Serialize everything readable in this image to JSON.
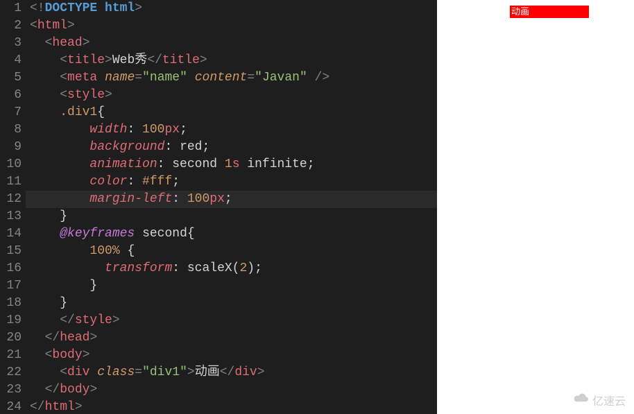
{
  "editor": {
    "line_count": 24,
    "highlighted_line": 12,
    "lines": [
      {
        "n": 1,
        "t": [
          [
            "brkt",
            "<!"
          ],
          [
            "doctype",
            "DOCTYPE html"
          ],
          [
            "brkt",
            ">"
          ]
        ]
      },
      {
        "n": 2,
        "t": [
          [
            "brkt",
            "<"
          ],
          [
            "tag",
            "html"
          ],
          [
            "brkt",
            ">"
          ]
        ]
      },
      {
        "n": 3,
        "t": [
          [
            "txt",
            "  "
          ],
          [
            "brkt",
            "<"
          ],
          [
            "tag",
            "head"
          ],
          [
            "brkt",
            ">"
          ]
        ]
      },
      {
        "n": 4,
        "t": [
          [
            "txt",
            "    "
          ],
          [
            "brkt",
            "<"
          ],
          [
            "tag",
            "title"
          ],
          [
            "brkt",
            ">"
          ],
          [
            "txt",
            "Web秀"
          ],
          [
            "brkt",
            "</"
          ],
          [
            "tag",
            "title"
          ],
          [
            "brkt",
            ">"
          ]
        ]
      },
      {
        "n": 5,
        "t": [
          [
            "txt",
            "    "
          ],
          [
            "brkt",
            "<"
          ],
          [
            "tag",
            "meta"
          ],
          [
            "txt",
            " "
          ],
          [
            "attr",
            "name"
          ],
          [
            "brkt",
            "="
          ],
          [
            "str",
            "\"name\""
          ],
          [
            "txt",
            " "
          ],
          [
            "attr",
            "content"
          ],
          [
            "brkt",
            "="
          ],
          [
            "str",
            "\"Javan\""
          ],
          [
            "txt",
            " "
          ],
          [
            "brkt",
            "/>"
          ]
        ]
      },
      {
        "n": 6,
        "t": [
          [
            "txt",
            "    "
          ],
          [
            "brkt",
            "<"
          ],
          [
            "tag",
            "style"
          ],
          [
            "brkt",
            ">"
          ]
        ]
      },
      {
        "n": 7,
        "t": [
          [
            "txt",
            "    "
          ],
          [
            "sel",
            ".div1"
          ],
          [
            "punc",
            "{"
          ]
        ]
      },
      {
        "n": 8,
        "t": [
          [
            "txt",
            "        "
          ],
          [
            "prop",
            "width"
          ],
          [
            "punc",
            ": "
          ],
          [
            "num",
            "100"
          ],
          [
            "unit",
            "px"
          ],
          [
            "punc",
            ";"
          ]
        ]
      },
      {
        "n": 9,
        "t": [
          [
            "txt",
            "        "
          ],
          [
            "prop",
            "background"
          ],
          [
            "punc",
            ": "
          ],
          [
            "val",
            "red"
          ],
          [
            "punc",
            ";"
          ]
        ]
      },
      {
        "n": 10,
        "t": [
          [
            "txt",
            "        "
          ],
          [
            "prop",
            "animation"
          ],
          [
            "punc",
            ": "
          ],
          [
            "val",
            "second "
          ],
          [
            "num",
            "1"
          ],
          [
            "unit",
            "s"
          ],
          [
            "val",
            " infinite"
          ],
          [
            "punc",
            ";"
          ]
        ]
      },
      {
        "n": 11,
        "t": [
          [
            "txt",
            "        "
          ],
          [
            "prop",
            "color"
          ],
          [
            "punc",
            ": "
          ],
          [
            "hex",
            "#fff"
          ],
          [
            "punc",
            ";"
          ]
        ]
      },
      {
        "n": 12,
        "t": [
          [
            "txt",
            "        "
          ],
          [
            "prop",
            "margin-left"
          ],
          [
            "punc",
            ": "
          ],
          [
            "num",
            "100"
          ],
          [
            "unit",
            "px"
          ],
          [
            "punc",
            ";"
          ]
        ]
      },
      {
        "n": 13,
        "t": [
          [
            "txt",
            "    "
          ],
          [
            "punc",
            "}"
          ]
        ]
      },
      {
        "n": 14,
        "t": [
          [
            "txt",
            "    "
          ],
          [
            "keyword",
            "@keyframes"
          ],
          [
            "txt",
            " "
          ],
          [
            "val",
            "second"
          ],
          [
            "punc",
            "{"
          ]
        ]
      },
      {
        "n": 15,
        "t": [
          [
            "txt",
            "        "
          ],
          [
            "pct",
            "100%"
          ],
          [
            "txt",
            " "
          ],
          [
            "punc",
            "{"
          ]
        ]
      },
      {
        "n": 16,
        "t": [
          [
            "txt",
            "          "
          ],
          [
            "prop",
            "transform"
          ],
          [
            "punc",
            ": "
          ],
          [
            "val",
            "scaleX("
          ],
          [
            "num",
            "2"
          ],
          [
            "val",
            ")"
          ],
          [
            "punc",
            ";"
          ]
        ]
      },
      {
        "n": 17,
        "t": [
          [
            "txt",
            "        "
          ],
          [
            "punc",
            "}"
          ]
        ]
      },
      {
        "n": 18,
        "t": [
          [
            "txt",
            "    "
          ],
          [
            "punc",
            "}"
          ]
        ]
      },
      {
        "n": 19,
        "t": [
          [
            "txt",
            "    "
          ],
          [
            "brkt",
            "</"
          ],
          [
            "tag",
            "style"
          ],
          [
            "brkt",
            ">"
          ]
        ]
      },
      {
        "n": 20,
        "t": [
          [
            "txt",
            "  "
          ],
          [
            "brkt",
            "</"
          ],
          [
            "tag",
            "head"
          ],
          [
            "brkt",
            ">"
          ]
        ]
      },
      {
        "n": 21,
        "t": [
          [
            "txt",
            "  "
          ],
          [
            "brkt",
            "<"
          ],
          [
            "tag",
            "body"
          ],
          [
            "brkt",
            ">"
          ]
        ]
      },
      {
        "n": 22,
        "t": [
          [
            "txt",
            "    "
          ],
          [
            "brkt",
            "<"
          ],
          [
            "tag",
            "div"
          ],
          [
            "txt",
            " "
          ],
          [
            "attr",
            "class"
          ],
          [
            "brkt",
            "="
          ],
          [
            "str",
            "\"div1\""
          ],
          [
            "brkt",
            ">"
          ],
          [
            "txt",
            "动画"
          ],
          [
            "brkt",
            "</"
          ],
          [
            "tag",
            "div"
          ],
          [
            "brkt",
            ">"
          ]
        ]
      },
      {
        "n": 23,
        "t": [
          [
            "txt",
            "  "
          ],
          [
            "brkt",
            "</"
          ],
          [
            "tag",
            "body"
          ],
          [
            "brkt",
            ">"
          ]
        ]
      },
      {
        "n": 24,
        "t": [
          [
            "brkt",
            "</"
          ],
          [
            "tag",
            "html"
          ],
          [
            "brkt",
            ">"
          ]
        ]
      }
    ]
  },
  "render": {
    "div_text": "动画"
  },
  "watermark": {
    "text": "亿速云"
  }
}
